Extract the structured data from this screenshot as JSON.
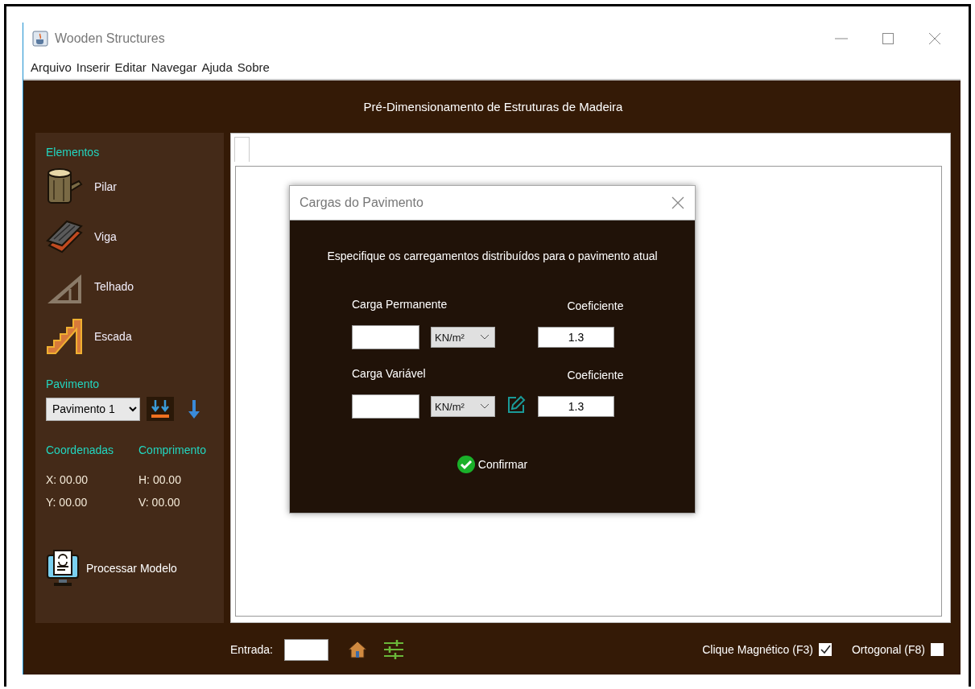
{
  "window": {
    "title": "Wooden Structures",
    "menu": [
      "Arquivo",
      "Inserir",
      "Editar",
      "Navegar",
      "Ajuda",
      "Sobre"
    ],
    "header": "Pré-Dimensionamento de Estruturas de Madeira"
  },
  "sidebar": {
    "elements_heading": "Elementos",
    "elements": [
      {
        "kind": "pillar",
        "label": "Pilar"
      },
      {
        "kind": "beam",
        "label": "Viga"
      },
      {
        "kind": "roof",
        "label": "Telhado"
      },
      {
        "kind": "stair",
        "label": "Escada"
      }
    ],
    "floor_heading": "Pavimento",
    "floor_select": "Pavimento 1",
    "coord_heading": "Coordenadas",
    "length_heading": "Comprimento",
    "coords": [
      "X: 00.00",
      "Y: 00.00"
    ],
    "lengths": [
      "H: 00.00",
      "V: 00.00"
    ],
    "process_button": "Processar Modelo"
  },
  "dialog": {
    "title": "Cargas do Pavimento",
    "instruction": "Especifique os carregamentos distribuídos para o pavimento atual",
    "loads": [
      {
        "label": "Carga Permanente",
        "unit": "KN/m²",
        "coefficient_label": "Coeficiente",
        "coefficient": "1.3",
        "edit_button": false
      },
      {
        "label": "Carga Variável",
        "unit": "KN/m²",
        "coefficient_label": "Coeficiente",
        "coefficient": "1.3",
        "edit_button": true
      }
    ],
    "confirm": "Confirmar"
  },
  "status_bar": {
    "input_label": "Entrada:",
    "options": [
      {
        "label": "Clique Magnético (F3)",
        "checked": true
      },
      {
        "label": "Ortogonal (F8)",
        "checked": false
      }
    ]
  }
}
